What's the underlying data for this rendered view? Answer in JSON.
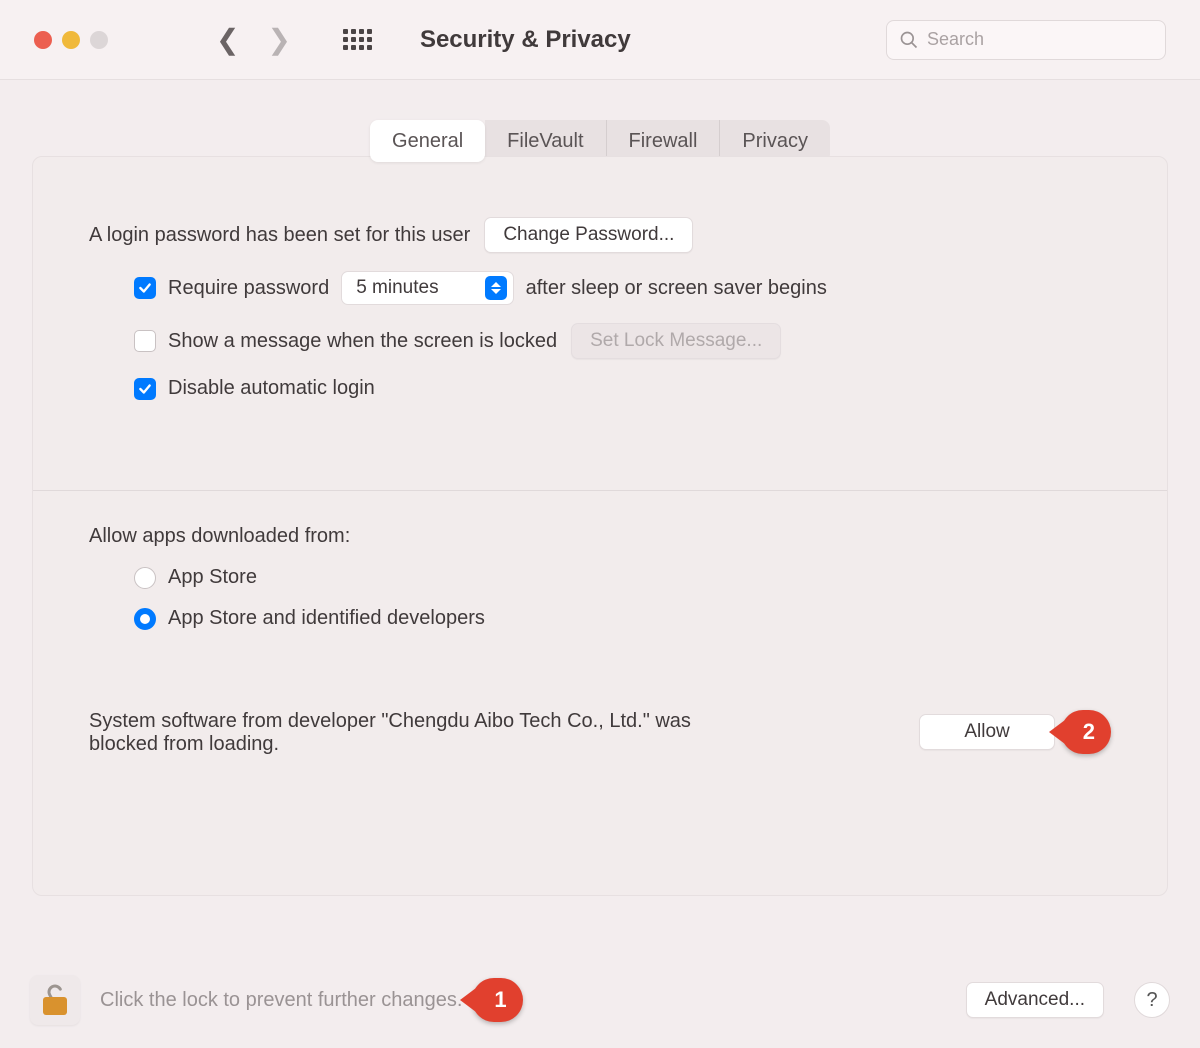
{
  "toolbar": {
    "title": "Security & Privacy",
    "search_placeholder": "Search"
  },
  "tabs": [
    "General",
    "FileVault",
    "Firewall",
    "Privacy"
  ],
  "active_tab": "General",
  "login": {
    "password_set_text": "A login password has been set for this user",
    "change_password_label": "Change Password...",
    "require_password_prefix": "Require password",
    "require_password_suffix": "after sleep or screen saver begins",
    "require_password_delay": "5 minutes",
    "show_message_label": "Show a message when the screen is locked",
    "set_lock_message_label": "Set Lock Message...",
    "disable_auto_login_label": "Disable automatic login",
    "require_password_checked": true,
    "show_message_checked": false,
    "disable_auto_login_checked": true
  },
  "allow_apps": {
    "section_label": "Allow apps downloaded from:",
    "options": [
      "App Store",
      "App Store and identified developers"
    ],
    "selected": "App Store and identified developers"
  },
  "blocked": {
    "message": "System software from developer \"Chengdu Aibo Tech Co., Ltd.\" was blocked from loading.",
    "allow_label": "Allow"
  },
  "footer": {
    "lock_text": "Click the lock to prevent further changes.",
    "advanced_label": "Advanced...",
    "help_label": "?"
  },
  "annotations": {
    "one": "1",
    "two": "2"
  }
}
